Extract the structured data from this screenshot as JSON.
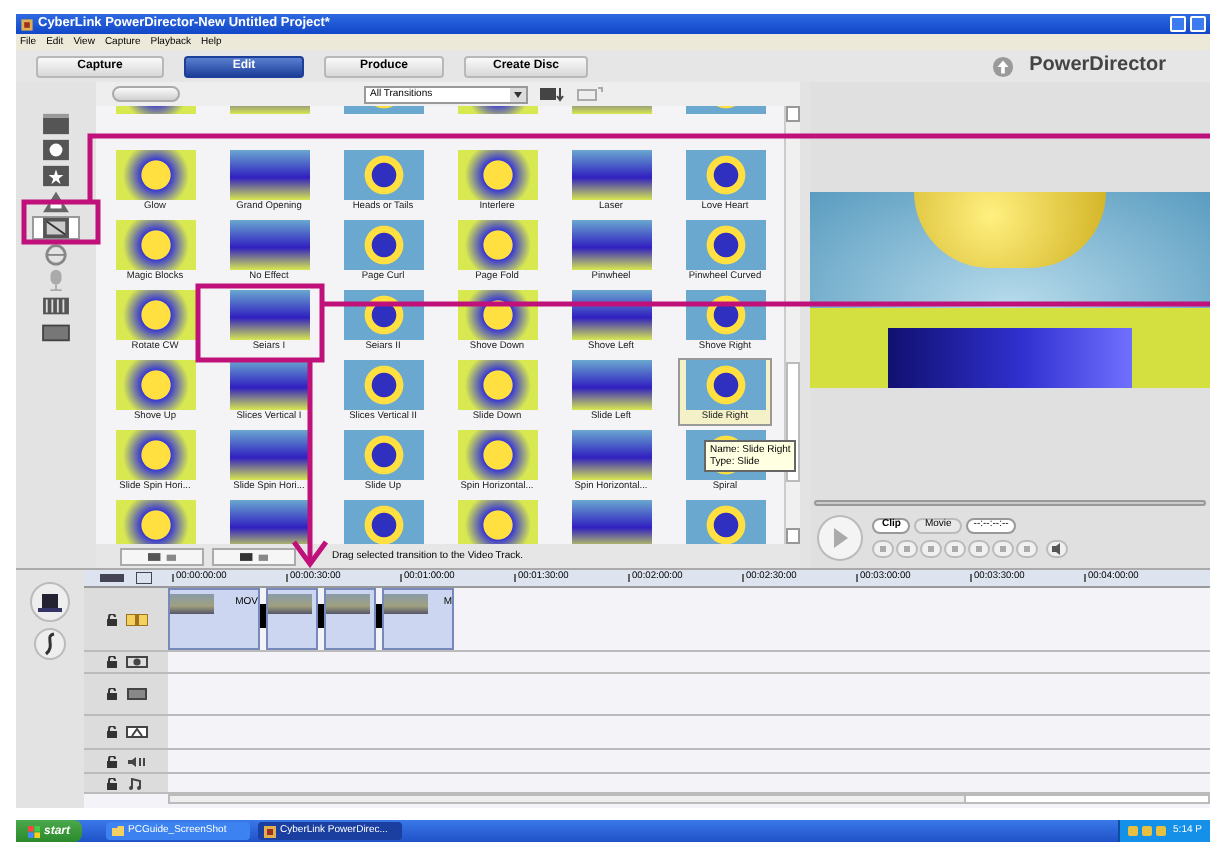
{
  "window": {
    "title": "CyberLink PowerDirector-New Untitled Project*"
  },
  "menu": [
    "File",
    "Edit",
    "View",
    "Capture",
    "Playback",
    "Help"
  ],
  "modes": [
    {
      "label": "Capture",
      "selected": false
    },
    {
      "label": "Edit",
      "selected": true
    },
    {
      "label": "Produce",
      "selected": false
    },
    {
      "label": "Create Disc",
      "selected": false
    }
  ],
  "brand": "PowerDirector",
  "sidebar": [
    {
      "selected": false
    },
    {
      "selected": false
    },
    {
      "selected": false
    },
    {
      "selected": false
    },
    {
      "selected": true
    },
    {
      "selected": false
    },
    {
      "selected": false
    },
    {
      "selected": false
    },
    {
      "selected": false
    }
  ],
  "library": {
    "filter": "All Transitions",
    "items": [
      {
        "label": "Glow",
        "selected": false
      },
      {
        "label": "Grand Opening",
        "selected": false
      },
      {
        "label": "Heads or Tails",
        "selected": false
      },
      {
        "label": "Interlere",
        "selected": false
      },
      {
        "label": "Laser",
        "selected": false
      },
      {
        "label": "Love Heart",
        "selected": false
      },
      {
        "label": "Magic Blocks",
        "selected": false
      },
      {
        "label": "No Effect",
        "selected": false
      },
      {
        "label": "Page Curl",
        "selected": false
      },
      {
        "label": "Page Fold",
        "selected": false
      },
      {
        "label": "Pinwheel",
        "selected": false
      },
      {
        "label": "Pinwheel Curved",
        "selected": false
      },
      {
        "label": "Rotate CW",
        "selected": false
      },
      {
        "label": "Seiars I",
        "selected": false
      },
      {
        "label": "Seiars II",
        "selected": false
      },
      {
        "label": "Shove Down",
        "selected": false
      },
      {
        "label": "Shove Left",
        "selected": false
      },
      {
        "label": "Shove Right",
        "selected": false
      },
      {
        "label": "Shove Up",
        "selected": false
      },
      {
        "label": "Slices Vertical I",
        "selected": false
      },
      {
        "label": "Slices Vertical II",
        "selected": false
      },
      {
        "label": "Slide Down",
        "selected": false
      },
      {
        "label": "Slide Left",
        "selected": false
      },
      {
        "label": "Slide Right",
        "selected": true
      },
      {
        "label": "Slide Spin Hori...",
        "selected": false
      },
      {
        "label": "Slide Spin Hori...",
        "selected": false
      },
      {
        "label": "Slide Up",
        "selected": false
      },
      {
        "label": "Spin Horizontal...",
        "selected": false
      },
      {
        "label": "Spin Horizontal...",
        "selected": false
      },
      {
        "label": "Spiral",
        "selected": false
      }
    ],
    "hint": "Drag selected transition to the Video Track.",
    "tooltip": {
      "name": "Name: Slide Right",
      "type": "Type: Slide"
    }
  },
  "preview": {
    "tabs": [
      {
        "label": "Clip",
        "selected": true
      },
      {
        "label": "Movie",
        "selected": false
      }
    ],
    "timecode": "--:--:--:--"
  },
  "timeline": {
    "ticks": [
      "00:00:00:00",
      "00:00:30:00",
      "00:01:00:00",
      "00:01:30:00",
      "00:02:00:00",
      "00:02:30:00",
      "00:03:00:00",
      "00:03:30:00",
      "00:04:00:00"
    ],
    "clips": [
      {
        "label": "MOV",
        "transition_after": true
      },
      {
        "transition_after": true
      },
      {
        "transition_after": true
      },
      {
        "label": "M",
        "transition_after": false
      }
    ]
  },
  "taskbar": {
    "start": "start",
    "tasks": [
      {
        "label": "PCGuide_ScreenShot",
        "selected": false
      },
      {
        "label": "CyberLink PowerDirec...",
        "selected": true
      }
    ],
    "clock": "5:14 P"
  }
}
